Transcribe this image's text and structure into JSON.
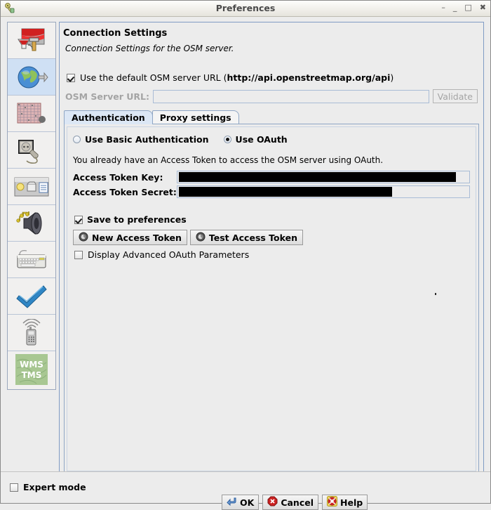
{
  "window": {
    "title": "Preferences",
    "icon": "josm-key-icon",
    "controls": [
      {
        "name": "shade-button",
        "glyph": "–"
      },
      {
        "name": "minimize-button",
        "glyph": "_"
      },
      {
        "name": "maximize-button",
        "glyph": "□"
      },
      {
        "name": "close-button",
        "glyph": "✖"
      }
    ]
  },
  "sidebar": {
    "items": [
      {
        "name": "display-settings",
        "icon": "paint-roller-icon",
        "selected": false
      },
      {
        "name": "connection-settings",
        "icon": "globe-plug-icon",
        "selected": true
      },
      {
        "name": "map-settings",
        "icon": "grid-map-icon",
        "selected": false
      },
      {
        "name": "plugins-settings",
        "icon": "power-socket-plug-icon",
        "selected": false
      },
      {
        "name": "toolbar-settings",
        "icon": "toolbar-window-icon",
        "selected": false
      },
      {
        "name": "audio-settings",
        "icon": "speaker-music-icon",
        "selected": false
      },
      {
        "name": "shortcut-settings",
        "icon": "keyboard-icon",
        "selected": false
      },
      {
        "name": "validator-settings",
        "icon": "blue-checkmark-icon",
        "selected": false
      },
      {
        "name": "remote-control-settings",
        "icon": "remote-control-icon",
        "selected": false
      },
      {
        "name": "imagery-settings",
        "icon": "wms-tms-icon",
        "selected": false,
        "label_line1": "WMS",
        "label_line2": "TMS"
      }
    ]
  },
  "panel": {
    "title": "Connection Settings",
    "subtitle": "Connection Settings for the OSM server.",
    "default_url_checkbox": {
      "checked": true,
      "text_prefix": "Use the default OSM server URL (",
      "url": "http://api.openstreetmap.org/api",
      "text_suffix": ")"
    },
    "server_url": {
      "label": "OSM Server URL:",
      "value": "",
      "placeholder": "",
      "disabled": true
    },
    "validate_button": {
      "label": "Validate",
      "disabled": true
    }
  },
  "tabs": [
    {
      "label": "Authentication",
      "active": true
    },
    {
      "label": "Proxy settings",
      "active": false
    }
  ],
  "auth": {
    "basic_radio": {
      "label": "Use Basic Authentication",
      "selected": false
    },
    "oauth_radio": {
      "label": "Use OAuth",
      "selected": true
    },
    "info": "You already have an Access Token to access the OSM server using OAuth.",
    "token_key": {
      "label": "Access Token Key:",
      "value": "",
      "redacted": true,
      "redaction_width_pct": 95
    },
    "token_secret": {
      "label": "Access Token Secret:",
      "value": "",
      "redacted": true,
      "redaction_width_pct": 73
    },
    "save_checkbox": {
      "label": "Save to preferences",
      "checked": true
    },
    "new_token_button": {
      "label": "New Access Token",
      "icon": "oauth-token-icon"
    },
    "test_token_button": {
      "label": "Test Access Token",
      "icon": "oauth-token-icon"
    },
    "advanced_checkbox": {
      "label": "Display Advanced OAuth Parameters",
      "checked": false
    }
  },
  "footer": {
    "expert_mode": {
      "label": "Expert mode",
      "checked": false
    },
    "ok_button": {
      "label": "OK",
      "icon": "enter-arrow-icon"
    },
    "cancel_button": {
      "label": "Cancel",
      "icon": "red-octagon-cancel-icon"
    },
    "help_button": {
      "label": "Help",
      "icon": "lifebuoy-help-icon"
    }
  },
  "colors": {
    "selection": "#cfe0f4",
    "panel_border": "#7f9bc4",
    "tab_active": "#dce7f5",
    "disabled_text": "#a4a4a4",
    "background": "#ececec"
  }
}
